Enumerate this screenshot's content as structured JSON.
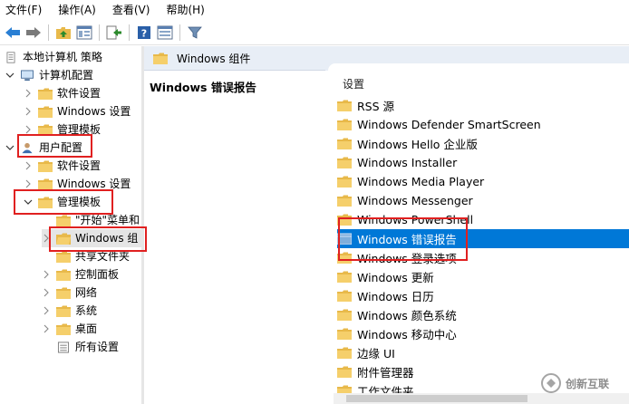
{
  "menubar": {
    "items": [
      "文件(F)",
      "操作(A)",
      "查看(V)",
      "帮助(H)"
    ]
  },
  "tree": {
    "root": "本地计算机 策略",
    "computer_config": "计算机配置",
    "cc_software": "软件设置",
    "cc_windows": "Windows 设置",
    "cc_admin": "管理模板",
    "user_config": "用户配置",
    "uc_software": "软件设置",
    "uc_windows": "Windows 设置",
    "uc_admin": "管理模板",
    "start_menu": "\"开始\"菜单和",
    "windows_components": "Windows 组",
    "shared_folders": "共享文件夹",
    "control_panel": "控制面板",
    "network": "网络",
    "system": "系统",
    "desktop": "桌面",
    "all_settings": "所有设置"
  },
  "right": {
    "header_title": "Windows 组件",
    "desc_title": "Windows 错误报告",
    "list_header": "设置",
    "items": [
      "RSS 源",
      "Windows Defender SmartScreen",
      "Windows Hello 企业版",
      "Windows Installer",
      "Windows Media Player",
      "Windows Messenger",
      "Windows PowerShell",
      "Windows 错误报告",
      "Windows 登录选项",
      "Windows 更新",
      "Windows 日历",
      "Windows 颜色系统",
      "Windows 移动中心",
      "边缘 UI",
      "附件管理器",
      "工作文件夹"
    ],
    "selected_index": 7
  },
  "watermark": {
    "text": "创新互联"
  },
  "colors": {
    "selection": "#0078d7",
    "highlight_box": "#e02020",
    "header_bg": "#e8eef6",
    "folder": "#e8b94a"
  }
}
